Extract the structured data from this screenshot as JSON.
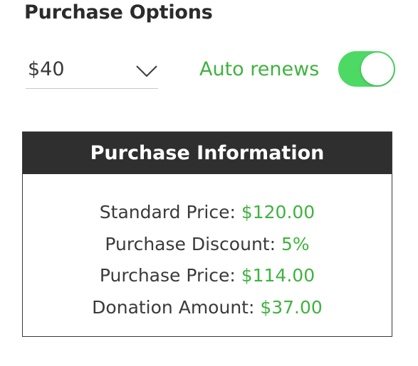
{
  "title": "Purchase Options",
  "amount_select": {
    "value": "$40"
  },
  "auto_renew": {
    "label": "Auto renews",
    "enabled": true
  },
  "purchase_info": {
    "header": "Purchase Information",
    "rows": [
      {
        "label": "Standard Price:",
        "value": "$120.00"
      },
      {
        "label": "Purchase Discount:",
        "value": "5%"
      },
      {
        "label": "Purchase Price:",
        "value": "$114.00"
      },
      {
        "label": "Donation Amount:",
        "value": "$37.00"
      }
    ]
  },
  "colors": {
    "accent_green": "#3fb33f",
    "toggle_on": "#4cd964",
    "header_bg": "#2f2f2f"
  }
}
